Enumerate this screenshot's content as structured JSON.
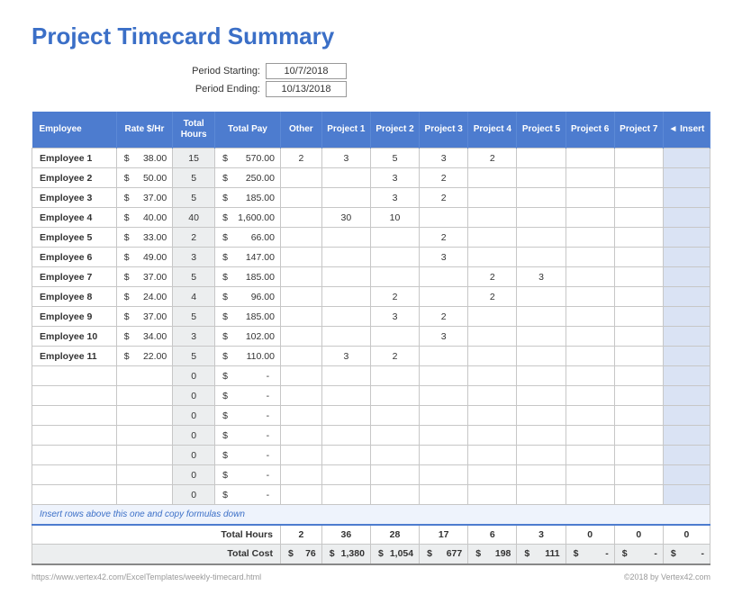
{
  "title": "Project Timecard Summary",
  "period": {
    "start_label": "Period Starting:",
    "start_value": "10/7/2018",
    "end_label": "Period Ending:",
    "end_value": "10/13/2018"
  },
  "headers": {
    "employee": "Employee",
    "rate": "Rate $/Hr",
    "total_hours": "Total Hours",
    "total_pay": "Total Pay",
    "other": "Other",
    "p1": "Project 1",
    "p2": "Project 2",
    "p3": "Project 3",
    "p4": "Project 4",
    "p5": "Project 5",
    "p6": "Project 6",
    "p7": "Project 7",
    "insert": "◄ Insert"
  },
  "rows": [
    {
      "emp": "Employee 1",
      "rate": "38.00",
      "hours": "15",
      "pay": "570.00",
      "other": "2",
      "p1": "3",
      "p2": "5",
      "p3": "3",
      "p4": "2",
      "p5": "",
      "p6": "",
      "p7": ""
    },
    {
      "emp": "Employee 2",
      "rate": "50.00",
      "hours": "5",
      "pay": "250.00",
      "other": "",
      "p1": "",
      "p2": "3",
      "p3": "2",
      "p4": "",
      "p5": "",
      "p6": "",
      "p7": ""
    },
    {
      "emp": "Employee 3",
      "rate": "37.00",
      "hours": "5",
      "pay": "185.00",
      "other": "",
      "p1": "",
      "p2": "3",
      "p3": "2",
      "p4": "",
      "p5": "",
      "p6": "",
      "p7": ""
    },
    {
      "emp": "Employee 4",
      "rate": "40.00",
      "hours": "40",
      "pay": "1,600.00",
      "other": "",
      "p1": "30",
      "p2": "10",
      "p3": "",
      "p4": "",
      "p5": "",
      "p6": "",
      "p7": ""
    },
    {
      "emp": "Employee 5",
      "rate": "33.00",
      "hours": "2",
      "pay": "66.00",
      "other": "",
      "p1": "",
      "p2": "",
      "p3": "2",
      "p4": "",
      "p5": "",
      "p6": "",
      "p7": ""
    },
    {
      "emp": "Employee 6",
      "rate": "49.00",
      "hours": "3",
      "pay": "147.00",
      "other": "",
      "p1": "",
      "p2": "",
      "p3": "3",
      "p4": "",
      "p5": "",
      "p6": "",
      "p7": ""
    },
    {
      "emp": "Employee 7",
      "rate": "37.00",
      "hours": "5",
      "pay": "185.00",
      "other": "",
      "p1": "",
      "p2": "",
      "p3": "",
      "p4": "2",
      "p5": "3",
      "p6": "",
      "p7": ""
    },
    {
      "emp": "Employee 8",
      "rate": "24.00",
      "hours": "4",
      "pay": "96.00",
      "other": "",
      "p1": "",
      "p2": "2",
      "p3": "",
      "p4": "2",
      "p5": "",
      "p6": "",
      "p7": ""
    },
    {
      "emp": "Employee 9",
      "rate": "37.00",
      "hours": "5",
      "pay": "185.00",
      "other": "",
      "p1": "",
      "p2": "3",
      "p3": "2",
      "p4": "",
      "p5": "",
      "p6": "",
      "p7": ""
    },
    {
      "emp": "Employee 10",
      "rate": "34.00",
      "hours": "3",
      "pay": "102.00",
      "other": "",
      "p1": "",
      "p2": "",
      "p3": "3",
      "p4": "",
      "p5": "",
      "p6": "",
      "p7": ""
    },
    {
      "emp": "Employee 11",
      "rate": "22.00",
      "hours": "5",
      "pay": "110.00",
      "other": "",
      "p1": "3",
      "p2": "2",
      "p3": "",
      "p4": "",
      "p5": "",
      "p6": "",
      "p7": ""
    },
    {
      "emp": "",
      "rate": "",
      "hours": "0",
      "pay": "-",
      "other": "",
      "p1": "",
      "p2": "",
      "p3": "",
      "p4": "",
      "p5": "",
      "p6": "",
      "p7": ""
    },
    {
      "emp": "",
      "rate": "",
      "hours": "0",
      "pay": "-",
      "other": "",
      "p1": "",
      "p2": "",
      "p3": "",
      "p4": "",
      "p5": "",
      "p6": "",
      "p7": ""
    },
    {
      "emp": "",
      "rate": "",
      "hours": "0",
      "pay": "-",
      "other": "",
      "p1": "",
      "p2": "",
      "p3": "",
      "p4": "",
      "p5": "",
      "p6": "",
      "p7": ""
    },
    {
      "emp": "",
      "rate": "",
      "hours": "0",
      "pay": "-",
      "other": "",
      "p1": "",
      "p2": "",
      "p3": "",
      "p4": "",
      "p5": "",
      "p6": "",
      "p7": ""
    },
    {
      "emp": "",
      "rate": "",
      "hours": "0",
      "pay": "-",
      "other": "",
      "p1": "",
      "p2": "",
      "p3": "",
      "p4": "",
      "p5": "",
      "p6": "",
      "p7": ""
    },
    {
      "emp": "",
      "rate": "",
      "hours": "0",
      "pay": "-",
      "other": "",
      "p1": "",
      "p2": "",
      "p3": "",
      "p4": "",
      "p5": "",
      "p6": "",
      "p7": ""
    },
    {
      "emp": "",
      "rate": "",
      "hours": "0",
      "pay": "-",
      "other": "",
      "p1": "",
      "p2": "",
      "p3": "",
      "p4": "",
      "p5": "",
      "p6": "",
      "p7": ""
    }
  ],
  "note": "Insert rows above this one and copy formulas down",
  "totals": {
    "hours_label": "Total Hours",
    "cost_label": "Total Cost",
    "hours": {
      "other": "2",
      "p1": "36",
      "p2": "28",
      "p3": "17",
      "p4": "6",
      "p5": "3",
      "p6": "0",
      "p7": "0",
      "insert": "0"
    },
    "cost": {
      "other": "76",
      "p1": "1,380",
      "p2": "1,054",
      "p3": "677",
      "p4": "198",
      "p5": "111",
      "p6": "-",
      "p7": "-",
      "insert": "-"
    }
  },
  "footer": {
    "left": "https://www.vertex42.com/ExcelTemplates/weekly-timecard.html",
    "right": "©2018 by Vertex42.com"
  },
  "chart_data": {
    "type": "table",
    "title": "Project Timecard Summary",
    "period_start": "10/7/2018",
    "period_end": "10/13/2018",
    "columns": [
      "Employee",
      "Rate $/Hr",
      "Total Hours",
      "Total Pay",
      "Other",
      "Project 1",
      "Project 2",
      "Project 3",
      "Project 4",
      "Project 5",
      "Project 6",
      "Project 7"
    ],
    "rows": [
      [
        "Employee 1",
        38.0,
        15,
        570.0,
        2,
        3,
        5,
        3,
        2,
        null,
        null,
        null
      ],
      [
        "Employee 2",
        50.0,
        5,
        250.0,
        null,
        null,
        3,
        2,
        null,
        null,
        null,
        null
      ],
      [
        "Employee 3",
        37.0,
        5,
        185.0,
        null,
        null,
        3,
        2,
        null,
        null,
        null,
        null
      ],
      [
        "Employee 4",
        40.0,
        40,
        1600.0,
        null,
        30,
        10,
        null,
        null,
        null,
        null,
        null
      ],
      [
        "Employee 5",
        33.0,
        2,
        66.0,
        null,
        null,
        null,
        2,
        null,
        null,
        null,
        null
      ],
      [
        "Employee 6",
        49.0,
        3,
        147.0,
        null,
        null,
        null,
        3,
        null,
        null,
        null,
        null
      ],
      [
        "Employee 7",
        37.0,
        5,
        185.0,
        null,
        null,
        null,
        null,
        2,
        3,
        null,
        null
      ],
      [
        "Employee 8",
        24.0,
        4,
        96.0,
        null,
        null,
        2,
        null,
        2,
        null,
        null,
        null
      ],
      [
        "Employee 9",
        37.0,
        5,
        185.0,
        null,
        null,
        3,
        2,
        null,
        null,
        null,
        null
      ],
      [
        "Employee 10",
        34.0,
        3,
        102.0,
        null,
        null,
        null,
        3,
        null,
        null,
        null,
        null
      ],
      [
        "Employee 11",
        22.0,
        5,
        110.0,
        null,
        3,
        2,
        null,
        null,
        null,
        null,
        null
      ]
    ],
    "total_hours": {
      "Other": 2,
      "Project 1": 36,
      "Project 2": 28,
      "Project 3": 17,
      "Project 4": 6,
      "Project 5": 3,
      "Project 6": 0,
      "Project 7": 0
    },
    "total_cost": {
      "Other": 76,
      "Project 1": 1380,
      "Project 2": 1054,
      "Project 3": 677,
      "Project 4": 198,
      "Project 5": 111,
      "Project 6": 0,
      "Project 7": 0
    }
  }
}
